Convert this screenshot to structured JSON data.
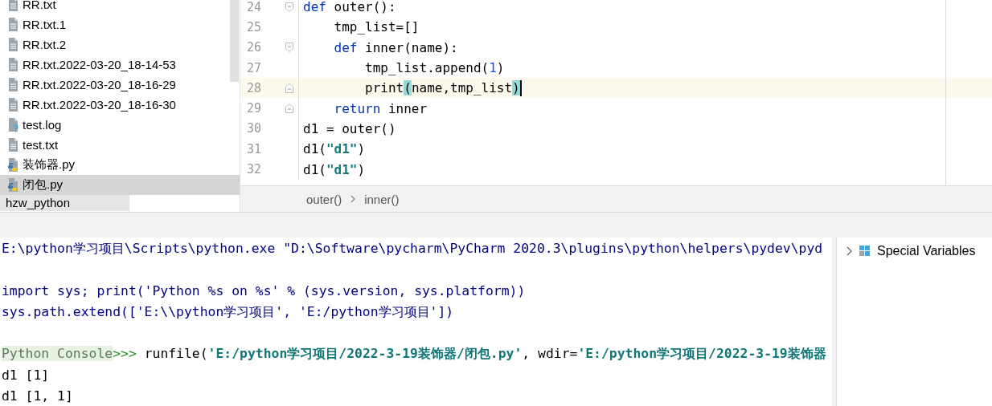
{
  "project_tree": {
    "items": [
      {
        "label": "RR.txt",
        "kind": "text",
        "selected": false
      },
      {
        "label": "RR.txt.1",
        "kind": "text",
        "selected": false
      },
      {
        "label": "RR.txt.2",
        "kind": "text",
        "selected": false
      },
      {
        "label": "RR.txt.2022-03-20_18-14-53",
        "kind": "text",
        "selected": false
      },
      {
        "label": "RR.txt.2022-03-20_18-16-29",
        "kind": "text",
        "selected": false
      },
      {
        "label": "RR.txt.2022-03-20_18-16-30",
        "kind": "text",
        "selected": false
      },
      {
        "label": "test.log",
        "kind": "unknown",
        "selected": false
      },
      {
        "label": "test.txt",
        "kind": "text",
        "selected": false
      },
      {
        "label": "装饰器.py",
        "kind": "python",
        "selected": false
      },
      {
        "label": "闭包.py",
        "kind": "python",
        "selected": true
      }
    ],
    "footer": "hzw_python"
  },
  "editor": {
    "lines": [
      {
        "number": "24",
        "fold_open": true,
        "fold_close": false,
        "current": false,
        "tokens": [
          {
            "kind": "keyword",
            "text": "def"
          },
          {
            "kind": "plain",
            "text": " outer():"
          }
        ]
      },
      {
        "number": "25",
        "fold_open": false,
        "fold_close": false,
        "current": false,
        "tokens": [
          {
            "kind": "plain",
            "text": "    tmp_list=[]"
          }
        ]
      },
      {
        "number": "26",
        "fold_open": true,
        "fold_close": false,
        "current": false,
        "tokens": [
          {
            "kind": "keyword",
            "text": "    def"
          },
          {
            "kind": "plain",
            "text": " inner(name):"
          }
        ]
      },
      {
        "number": "27",
        "fold_open": false,
        "fold_close": false,
        "current": false,
        "tokens": [
          {
            "kind": "plain",
            "text": "        tmp_list.append("
          },
          {
            "kind": "number",
            "text": "1"
          },
          {
            "kind": "plain",
            "text": ")"
          }
        ]
      },
      {
        "number": "28",
        "fold_open": false,
        "fold_close": true,
        "current": true,
        "tokens": [
          {
            "kind": "plain",
            "text": "        print"
          },
          {
            "kind": "brace",
            "text": "("
          },
          {
            "kind": "plain",
            "text": "name,tmp_list"
          },
          {
            "kind": "brace",
            "text": ")"
          }
        ]
      },
      {
        "number": "29",
        "fold_open": false,
        "fold_close": true,
        "current": false,
        "tokens": [
          {
            "kind": "keyword",
            "text": "    return"
          },
          {
            "kind": "plain",
            "text": " inner"
          }
        ]
      },
      {
        "number": "30",
        "fold_open": false,
        "fold_close": false,
        "current": false,
        "tokens": [
          {
            "kind": "plain",
            "text": "d1 = outer()"
          }
        ]
      },
      {
        "number": "31",
        "fold_open": false,
        "fold_close": false,
        "current": false,
        "tokens": [
          {
            "kind": "plain",
            "text": "d1("
          },
          {
            "kind": "string",
            "text": "\"d1\""
          },
          {
            "kind": "plain",
            "text": ")"
          }
        ]
      },
      {
        "number": "32",
        "fold_open": false,
        "fold_close": false,
        "current": false,
        "tokens": [
          {
            "kind": "plain",
            "text": "d1("
          },
          {
            "kind": "string",
            "text": "\"d1\""
          },
          {
            "kind": "plain",
            "text": ")"
          }
        ]
      }
    ],
    "breadcrumbs": [
      "outer()",
      "inner()"
    ]
  },
  "console": {
    "lines": [
      {
        "space_before": false,
        "tokens": [
          {
            "kind": "system",
            "text": "E:\\python学习项目\\Scripts\\python.exe \"D:\\Software\\pycharm\\PyCharm 2020.3\\plugins\\python\\helpers\\pydev\\pyd"
          }
        ]
      },
      {
        "space_before": true,
        "tokens": [
          {
            "kind": "system",
            "text": "import sys; print('Python %s on %s' % (sys.version, sys.platform))"
          }
        ]
      },
      {
        "space_before": false,
        "tokens": [
          {
            "kind": "system",
            "text": "sys.path.extend(['E:\\\\python学习项目', 'E:/python学习项目'])"
          }
        ]
      },
      {
        "space_before": true,
        "tokens": [
          {
            "kind": "prompt",
            "text": "Python Console"
          },
          {
            "kind": "arrows",
            "text": ">>> "
          },
          {
            "kind": "plain",
            "text": "runfile("
          },
          {
            "kind": "string",
            "text": "'E:/python学习项目/2022-3-19装饰器/闭包.py'"
          },
          {
            "kind": "plain",
            "text": ", wdir="
          },
          {
            "kind": "string",
            "text": "'E:/python学习项目/2022-3-19装饰器"
          }
        ]
      },
      {
        "space_before": false,
        "tokens": [
          {
            "kind": "plain",
            "text": "d1 [1]"
          }
        ]
      },
      {
        "space_before": false,
        "tokens": [
          {
            "kind": "plain",
            "text": "d1 [1, 1]"
          }
        ]
      }
    ]
  },
  "variables": {
    "items": [
      {
        "label": "Special Variables",
        "expanded": false
      }
    ]
  }
}
